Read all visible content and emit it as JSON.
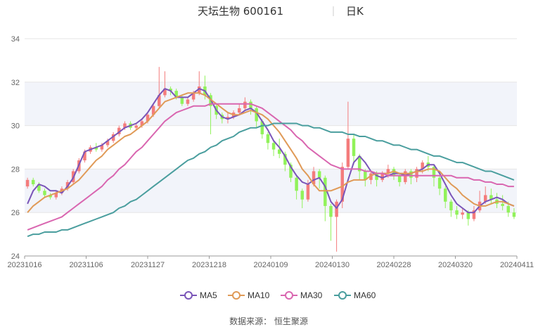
{
  "title": {
    "name": "天坛生物 600161",
    "period": "日K"
  },
  "source": "数据来源： 恒生聚源",
  "chart_data": {
    "type": "candlestick",
    "ylim": [
      24,
      34
    ],
    "yticks": [
      24,
      26,
      28,
      30,
      32,
      34
    ],
    "xticks": [
      "20231016",
      "20231106",
      "20231127",
      "20231218",
      "20240109",
      "20240130",
      "20240228",
      "20240320",
      "20240411"
    ],
    "grid": true,
    "legend_position": "bottom-center",
    "colors": {
      "up": "#f47c7c",
      "down": "#91f25a",
      "MA5": "#7a55b8",
      "MA10": "#e09a57",
      "MA30": "#d966b0",
      "MA60": "#4a9e9e",
      "band": "#f2f4fa",
      "grid": "#e6e6e6"
    },
    "candles": [
      [
        27.2,
        27.5,
        27.6,
        27.1
      ],
      [
        27.5,
        27.3,
        27.6,
        27.2
      ],
      [
        27.3,
        27.0,
        27.4,
        26.9
      ],
      [
        27.0,
        26.8,
        27.1,
        26.7
      ],
      [
        26.8,
        26.7,
        26.9,
        26.6
      ],
      [
        26.7,
        26.9,
        27.0,
        26.6
      ],
      [
        26.9,
        27.1,
        27.2,
        26.8
      ],
      [
        27.1,
        27.4,
        27.5,
        27.0
      ],
      [
        27.4,
        27.9,
        28.0,
        27.3
      ],
      [
        27.9,
        28.4,
        28.5,
        27.8
      ],
      [
        28.4,
        28.8,
        28.9,
        28.3
      ],
      [
        28.8,
        29.0,
        29.1,
        28.7
      ],
      [
        29.0,
        28.9,
        29.2,
        28.8
      ],
      [
        28.9,
        29.1,
        29.2,
        28.8
      ],
      [
        29.1,
        29.3,
        29.4,
        29.0
      ],
      [
        29.3,
        29.6,
        29.7,
        29.2
      ],
      [
        29.6,
        29.9,
        30.0,
        29.5
      ],
      [
        29.9,
        30.1,
        30.2,
        29.8
      ],
      [
        30.1,
        29.9,
        30.2,
        29.8
      ],
      [
        29.9,
        30.0,
        30.1,
        29.8
      ],
      [
        30.0,
        30.2,
        30.3,
        29.9
      ],
      [
        30.2,
        30.5,
        30.6,
        30.1
      ],
      [
        30.5,
        30.9,
        31.0,
        30.4
      ],
      [
        30.9,
        31.4,
        32.7,
        30.8
      ],
      [
        31.4,
        31.7,
        32.5,
        31.3
      ],
      [
        31.7,
        31.6,
        31.8,
        31.4
      ],
      [
        31.6,
        31.3,
        31.7,
        31.2
      ],
      [
        31.3,
        31.0,
        31.4,
        30.9
      ],
      [
        31.0,
        31.2,
        31.3,
        30.9
      ],
      [
        31.2,
        31.5,
        31.6,
        31.1
      ],
      [
        31.5,
        31.8,
        32.5,
        31.4
      ],
      [
        31.8,
        31.4,
        32.3,
        31.2
      ],
      [
        31.4,
        30.9,
        31.5,
        29.6
      ],
      [
        30.9,
        30.5,
        31.0,
        30.3
      ],
      [
        30.5,
        30.3,
        30.6,
        30.1
      ],
      [
        30.3,
        30.4,
        30.6,
        30.1
      ],
      [
        30.4,
        30.6,
        30.7,
        30.3
      ],
      [
        30.6,
        30.8,
        31.0,
        30.5
      ],
      [
        30.8,
        31.1,
        31.3,
        30.7
      ],
      [
        31.1,
        30.8,
        31.2,
        30.5
      ],
      [
        30.8,
        30.2,
        30.9,
        29.9
      ],
      [
        30.2,
        29.6,
        30.3,
        29.4
      ],
      [
        29.6,
        29.2,
        29.7,
        28.9
      ],
      [
        29.2,
        28.9,
        29.3,
        28.6
      ],
      [
        28.9,
        28.7,
        29.4,
        28.5
      ],
      [
        28.7,
        28.2,
        28.8,
        27.9
      ],
      [
        28.2,
        27.6,
        28.3,
        27.4
      ],
      [
        27.6,
        27.0,
        27.7,
        26.6
      ],
      [
        27.0,
        26.6,
        27.1,
        26.2
      ],
      [
        26.6,
        27.3,
        27.5,
        26.5
      ],
      [
        27.3,
        27.9,
        28.1,
        27.2
      ],
      [
        27.9,
        27.6,
        28.0,
        27.1
      ],
      [
        27.6,
        26.3,
        27.7,
        25.6
      ],
      [
        26.3,
        25.8,
        26.4,
        24.7
      ],
      [
        25.8,
        26.5,
        26.6,
        24.2
      ],
      [
        26.5,
        28.1,
        28.3,
        26.2
      ],
      [
        28.1,
        29.4,
        31.1,
        28.0
      ],
      [
        29.4,
        28.6,
        29.6,
        28.2
      ],
      [
        28.6,
        27.9,
        28.7,
        27.5
      ],
      [
        27.9,
        27.5,
        28.0,
        27.2
      ],
      [
        27.5,
        27.8,
        27.9,
        27.3
      ],
      [
        27.8,
        27.5,
        27.9,
        27.2
      ],
      [
        27.5,
        27.8,
        27.9,
        27.4
      ],
      [
        27.8,
        28.0,
        28.2,
        27.6
      ],
      [
        28.0,
        27.7,
        28.1,
        27.5
      ],
      [
        27.7,
        27.4,
        27.8,
        27.2
      ],
      [
        27.4,
        27.9,
        28.0,
        27.3
      ],
      [
        27.9,
        27.6,
        28.0,
        27.3
      ],
      [
        27.6,
        28.0,
        28.1,
        27.4
      ],
      [
        28.0,
        28.3,
        28.4,
        27.8
      ],
      [
        28.3,
        28.1,
        28.6,
        27.9
      ],
      [
        28.1,
        27.6,
        28.2,
        27.2
      ],
      [
        27.6,
        27.1,
        27.7,
        26.8
      ],
      [
        27.1,
        26.5,
        27.2,
        26.2
      ],
      [
        26.5,
        26.1,
        26.6,
        25.8
      ],
      [
        26.1,
        25.9,
        26.3,
        25.7
      ],
      [
        25.9,
        26.0,
        26.2,
        25.7
      ],
      [
        26.0,
        25.7,
        26.1,
        25.4
      ],
      [
        25.7,
        26.1,
        26.3,
        25.6
      ],
      [
        26.1,
        26.5,
        27.0,
        26.0
      ],
      [
        26.5,
        26.8,
        27.2,
        26.4
      ],
      [
        26.8,
        26.6,
        27.1,
        26.4
      ],
      [
        26.6,
        26.4,
        26.9,
        26.2
      ],
      [
        26.4,
        26.3,
        26.8,
        26.1
      ],
      [
        26.3,
        26.0,
        26.5,
        25.8
      ],
      [
        26.0,
        25.8,
        26.2,
        25.7
      ]
    ],
    "series": [
      {
        "name": "MA5",
        "values": [
          26.4,
          27.0,
          27.3,
          27.2,
          27.0,
          27.0,
          26.9,
          27.2,
          27.6,
          28.2,
          28.8,
          28.9,
          29.0,
          29.1,
          29.3,
          29.5,
          29.7,
          29.9,
          30.0,
          30.1,
          30.3,
          30.6,
          31.0,
          31.4,
          31.7,
          31.6,
          31.3,
          31.3,
          31.3,
          31.5,
          31.7,
          31.6,
          31.2,
          30.7,
          30.4,
          30.3,
          30.4,
          30.5,
          30.7,
          30.8,
          30.6,
          30.2,
          29.8,
          29.3,
          29.0,
          28.6,
          28.1,
          27.7,
          27.4,
          27.3,
          27.5,
          27.6,
          27.2,
          26.5,
          26.2,
          26.6,
          27.5,
          28.3,
          28.6,
          28.3,
          27.9,
          27.7,
          27.6,
          27.7,
          27.8,
          27.8,
          27.7,
          27.8,
          27.9,
          28.0,
          28.2,
          28.2,
          27.8,
          27.3,
          26.8,
          26.4,
          26.2,
          26.0,
          26.0,
          26.3,
          26.5,
          26.6,
          26.7,
          26.6,
          26.4,
          26.3
        ]
      },
      {
        "name": "MA10",
        "values": [
          26.0,
          26.3,
          26.5,
          26.7,
          26.8,
          26.9,
          27.0,
          27.1,
          27.3,
          27.5,
          27.8,
          28.1,
          28.4,
          28.6,
          28.9,
          29.1,
          29.3,
          29.5,
          29.6,
          29.8,
          30.0,
          30.2,
          30.5,
          30.8,
          31.1,
          31.2,
          31.3,
          31.4,
          31.5,
          31.5,
          31.5,
          31.4,
          31.2,
          31.0,
          30.8,
          30.6,
          30.5,
          30.5,
          30.6,
          30.7,
          30.6,
          30.5,
          30.3,
          30.0,
          29.7,
          29.3,
          28.9,
          28.5,
          28.0,
          27.7,
          27.3,
          27.0,
          27.0,
          27.0,
          27.1,
          27.2,
          27.4,
          27.5,
          27.5,
          27.5,
          27.7,
          27.8,
          27.8,
          27.8,
          27.9,
          27.8,
          27.8,
          27.8,
          27.9,
          27.9,
          28.0,
          28.0,
          27.9,
          27.6,
          27.3,
          27.1,
          26.8,
          26.6,
          26.4,
          26.3,
          26.3,
          26.4,
          26.5,
          26.5,
          26.4,
          26.3
        ]
      },
      {
        "name": "MA30",
        "values": [
          25.2,
          25.3,
          25.4,
          25.5,
          25.6,
          25.7,
          25.8,
          26.0,
          26.2,
          26.4,
          26.6,
          26.8,
          27.0,
          27.2,
          27.5,
          27.7,
          28.0,
          28.2,
          28.5,
          28.8,
          29.0,
          29.3,
          29.6,
          29.9,
          30.2,
          30.4,
          30.6,
          30.7,
          30.8,
          30.9,
          30.9,
          30.9,
          31.0,
          31.0,
          31.0,
          31.0,
          31.0,
          31.0,
          31.0,
          31.0,
          30.9,
          30.8,
          30.6,
          30.4,
          30.2,
          30.0,
          29.8,
          29.5,
          29.3,
          29.0,
          28.8,
          28.6,
          28.4,
          28.2,
          28.1,
          28.0,
          28.0,
          28.0,
          28.0,
          27.9,
          27.9,
          27.8,
          27.8,
          27.7,
          27.7,
          27.7,
          27.7,
          27.7,
          27.7,
          27.7,
          27.7,
          27.7,
          27.7,
          27.7,
          27.7,
          27.6,
          27.6,
          27.6,
          27.5,
          27.5,
          27.4,
          27.4,
          27.3,
          27.3,
          27.2,
          27.2
        ]
      },
      {
        "name": "MA60",
        "values": [
          24.9,
          25.0,
          25.0,
          25.1,
          25.1,
          25.1,
          25.2,
          25.2,
          25.3,
          25.4,
          25.5,
          25.6,
          25.7,
          25.8,
          25.9,
          26.0,
          26.2,
          26.3,
          26.5,
          26.6,
          26.8,
          27.0,
          27.2,
          27.4,
          27.6,
          27.8,
          28.0,
          28.2,
          28.4,
          28.5,
          28.7,
          28.8,
          29.0,
          29.1,
          29.3,
          29.4,
          29.5,
          29.7,
          29.8,
          29.9,
          29.9,
          30.0,
          30.0,
          30.1,
          30.1,
          30.1,
          30.1,
          30.1,
          30.0,
          30.0,
          29.9,
          29.9,
          29.8,
          29.7,
          29.7,
          29.7,
          29.6,
          29.6,
          29.5,
          29.5,
          29.4,
          29.3,
          29.3,
          29.2,
          29.1,
          29.1,
          29.0,
          28.9,
          28.9,
          28.8,
          28.7,
          28.6,
          28.6,
          28.5,
          28.4,
          28.3,
          28.3,
          28.2,
          28.1,
          28.0,
          27.9,
          27.9,
          27.8,
          27.7,
          27.6,
          27.5
        ]
      }
    ]
  }
}
